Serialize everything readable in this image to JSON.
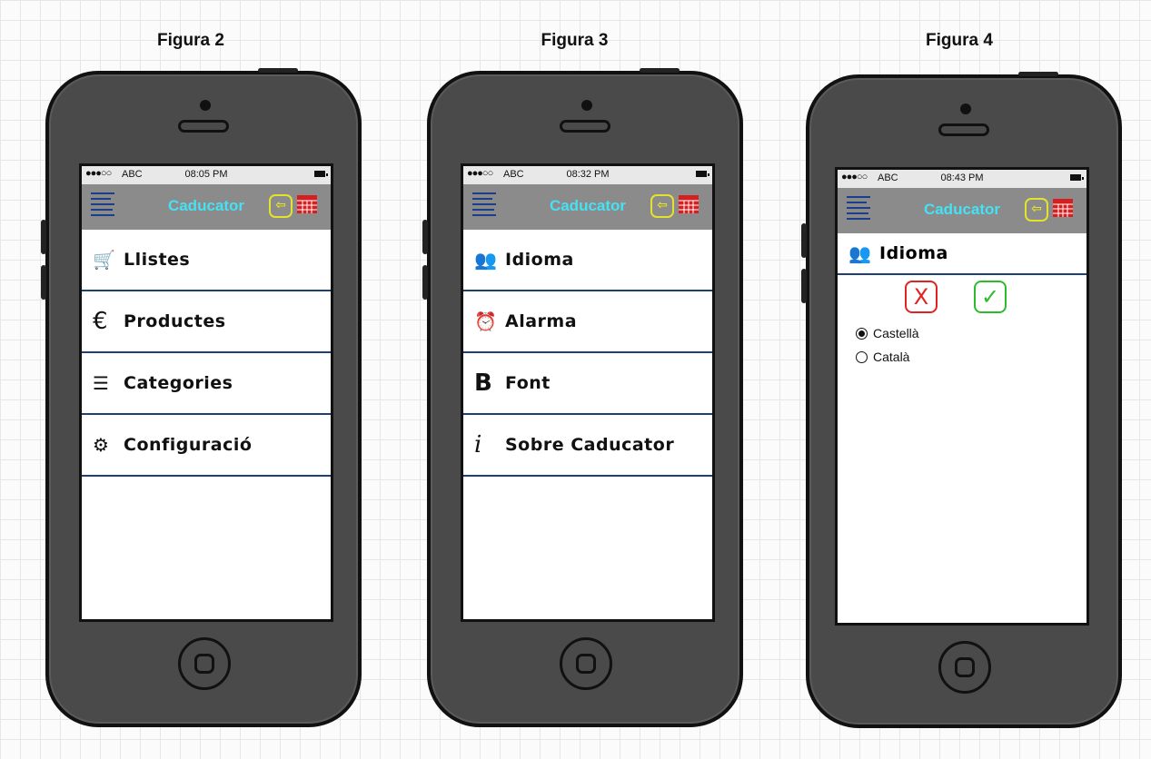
{
  "figures": [
    {
      "title": "Figura 2",
      "status": {
        "signal": "●●●○○",
        "carrier": "ABC",
        "time": "08:05 PM"
      },
      "app_title": "Caducator",
      "rows": [
        {
          "icon": "cart-icon",
          "glyph": "🛒",
          "label": "Llistes"
        },
        {
          "icon": "euro-icon",
          "glyph": "€",
          "label": "Productes"
        },
        {
          "icon": "lines-icon",
          "glyph": "☰",
          "label": "Categories"
        },
        {
          "icon": "gear-icon",
          "glyph": "⚙",
          "label": "Configuració"
        }
      ]
    },
    {
      "title": "Figura 3",
      "status": {
        "signal": "●●●○○",
        "carrier": "ABC",
        "time": "08:32 PM"
      },
      "app_title": "Caducator",
      "rows": [
        {
          "icon": "people-icon",
          "glyph": "👥",
          "label": "Idioma"
        },
        {
          "icon": "alarm-icon",
          "glyph": "⏰",
          "label": "Alarma"
        },
        {
          "icon": "bold-icon",
          "glyph": "B",
          "label": "Font"
        },
        {
          "icon": "info-icon",
          "glyph": "i",
          "label": "Sobre Caducator"
        }
      ]
    },
    {
      "title": "Figura 4",
      "status": {
        "signal": "●●●○○",
        "carrier": "ABC",
        "time": "08:43 PM"
      },
      "app_title": "Caducator",
      "section_title": "Idioma",
      "cancel_symbol": "X",
      "confirm_symbol": "✓",
      "options": [
        {
          "label": "Castellà",
          "selected": true
        },
        {
          "label": "Català",
          "selected": false
        }
      ]
    }
  ],
  "colors": {
    "phone_body": "#4a4a4a",
    "nav_bar": "#8b8b8b",
    "title": "#45e1f4",
    "back_icon": "#e3e22c",
    "calendar_icon": "#d42020",
    "menu_icon": "#1c3e8a",
    "cancel": "#e02222",
    "confirm": "#2dbb2d"
  }
}
